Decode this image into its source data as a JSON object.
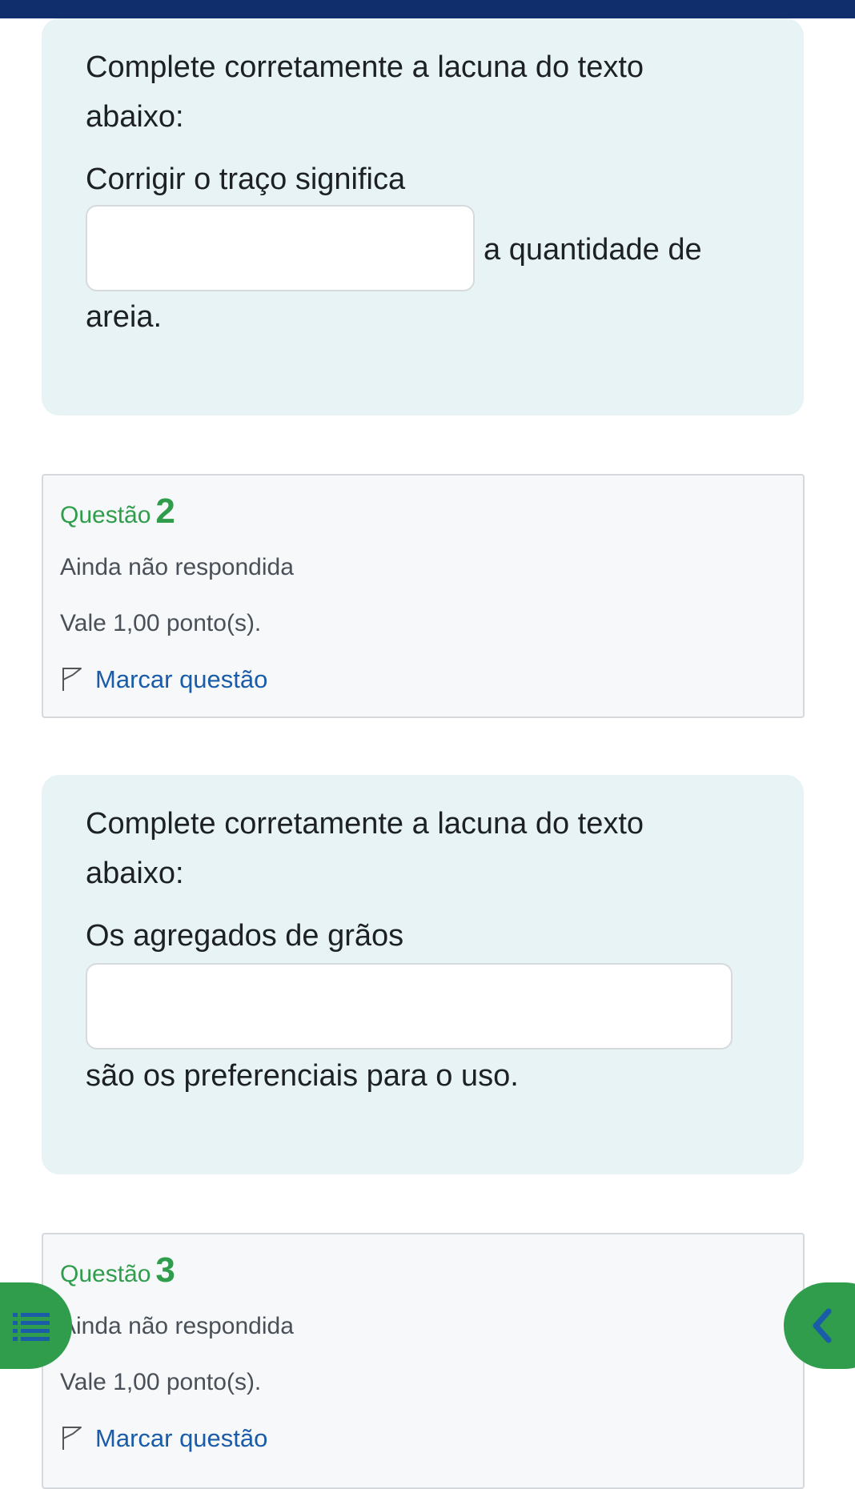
{
  "q1": {
    "instruction_line1": "Complete corretamente a lacuna do texto",
    "instruction_line2": "abaixo:",
    "sentence_start": "Corrigir o traço significa",
    "sentence_after_blank": "a quantidade de",
    "sentence_end": "areia.",
    "blank_value": ""
  },
  "q2_info": {
    "label": "Questão",
    "number": "2",
    "status": "Ainda não respondida",
    "points": "Vale 1,00 ponto(s).",
    "flag_label": "Marcar questão"
  },
  "q2": {
    "instruction_line1": "Complete corretamente a lacuna do texto",
    "instruction_line2": "abaixo:",
    "sentence_start": "Os agregados de grãos",
    "sentence_end": "são os preferenciais para o uso.",
    "blank_value": ""
  },
  "q3_info": {
    "label": "Questão",
    "number": "3",
    "status": "Ainda não respondida",
    "points": "Vale 1,00 ponto(s).",
    "flag_label": "Marcar questão"
  },
  "colors": {
    "header": "#0f2e6b",
    "question_bg": "#e7f3f5",
    "accent_green": "#2f9d4b",
    "link_blue": "#1a5ca8"
  },
  "icons": {
    "nav_menu": "list-icon",
    "nav_back": "chevron-left-icon",
    "flag": "flag-icon"
  }
}
